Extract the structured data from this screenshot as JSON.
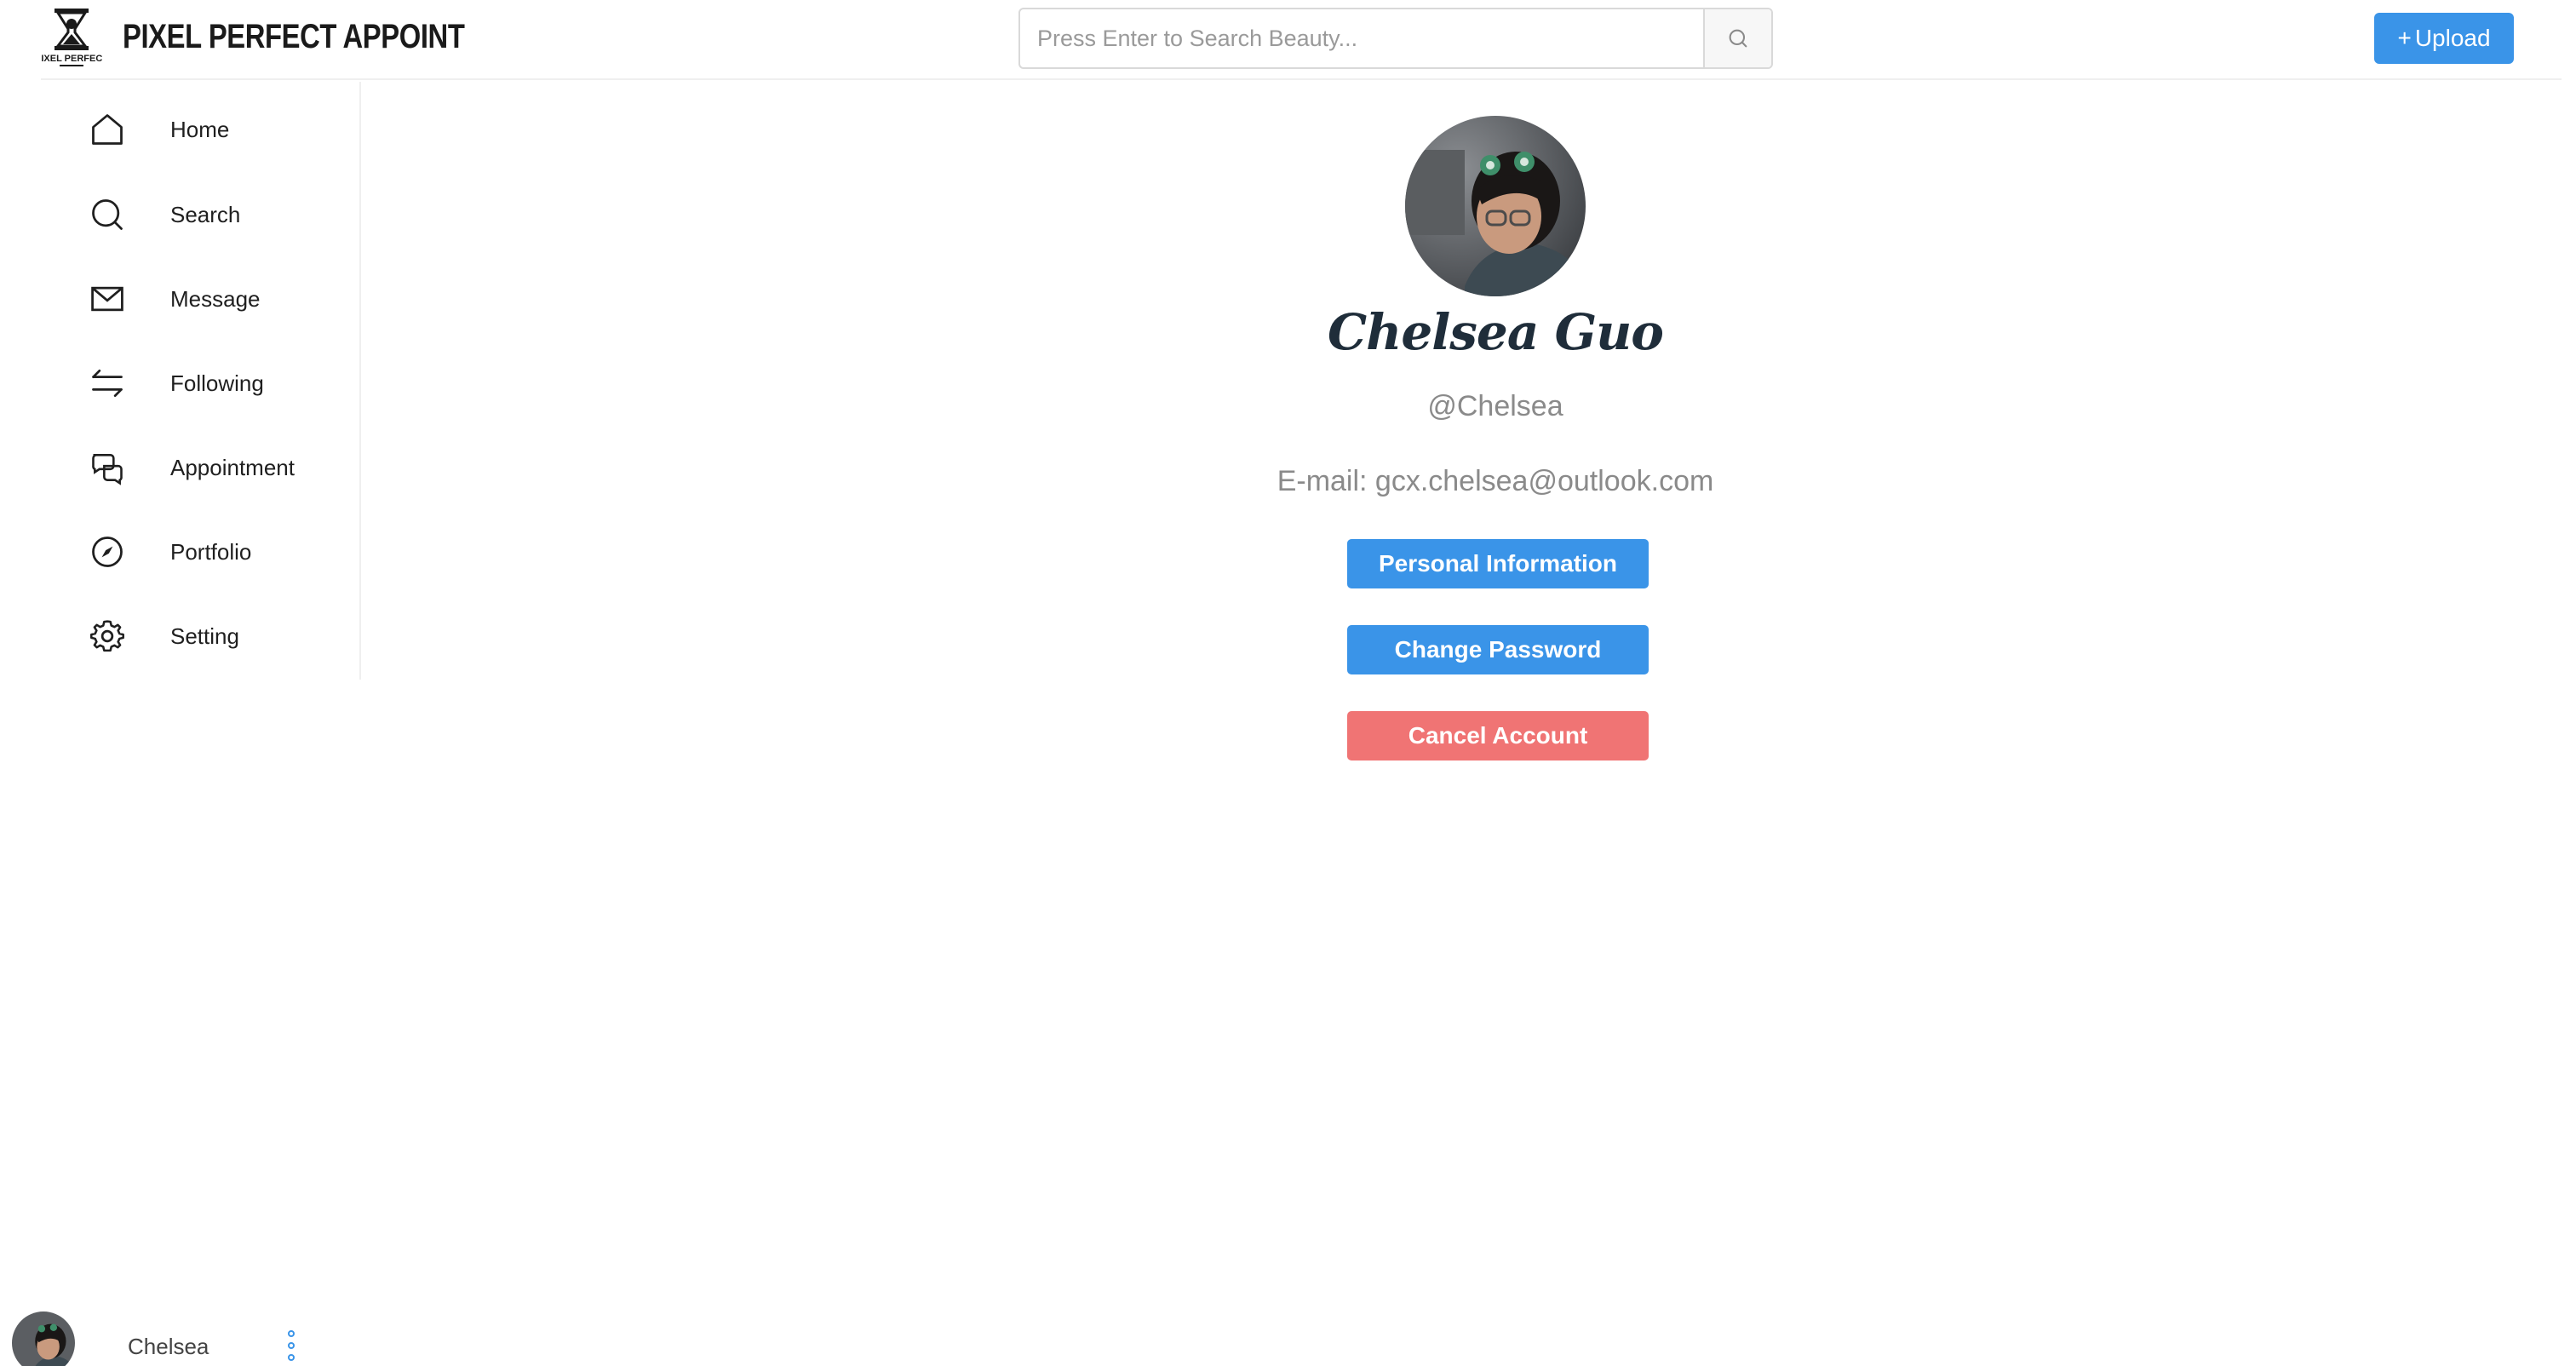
{
  "header": {
    "brand": "PIXEL PERFECT APPOINT",
    "logo_text": "PIXEL PERFECT",
    "search_placeholder": "Press Enter to Search Beauty...",
    "search_icon": "search-icon",
    "upload_icon": "+",
    "upload_label": "Upload"
  },
  "sidebar": {
    "items": [
      {
        "label": "Home",
        "icon": "home-icon"
      },
      {
        "label": "Search",
        "icon": "search-icon"
      },
      {
        "label": "Message",
        "icon": "mail-icon"
      },
      {
        "label": "Following",
        "icon": "swap-arrows-icon"
      },
      {
        "label": "Appointment",
        "icon": "chat-bubbles-icon"
      },
      {
        "label": "Portfolio",
        "icon": "compass-icon"
      },
      {
        "label": "Setting",
        "icon": "gear-icon"
      }
    ]
  },
  "profile": {
    "name": "Chelsea Guo",
    "handle": "@Chelsea",
    "email": "E-mail: gcx.chelsea@outlook.com",
    "personal_info_label": "Personal Information",
    "change_password_label": "Change Password",
    "cancel_account_label": "Cancel Account"
  },
  "footer": {
    "username": "Chelsea",
    "more_icon": "vertical-dots-icon"
  },
  "colors": {
    "primary": "#3a94e8",
    "danger": "#f07474",
    "name": "#1f2d3a",
    "muted": "#8a8a8a"
  }
}
